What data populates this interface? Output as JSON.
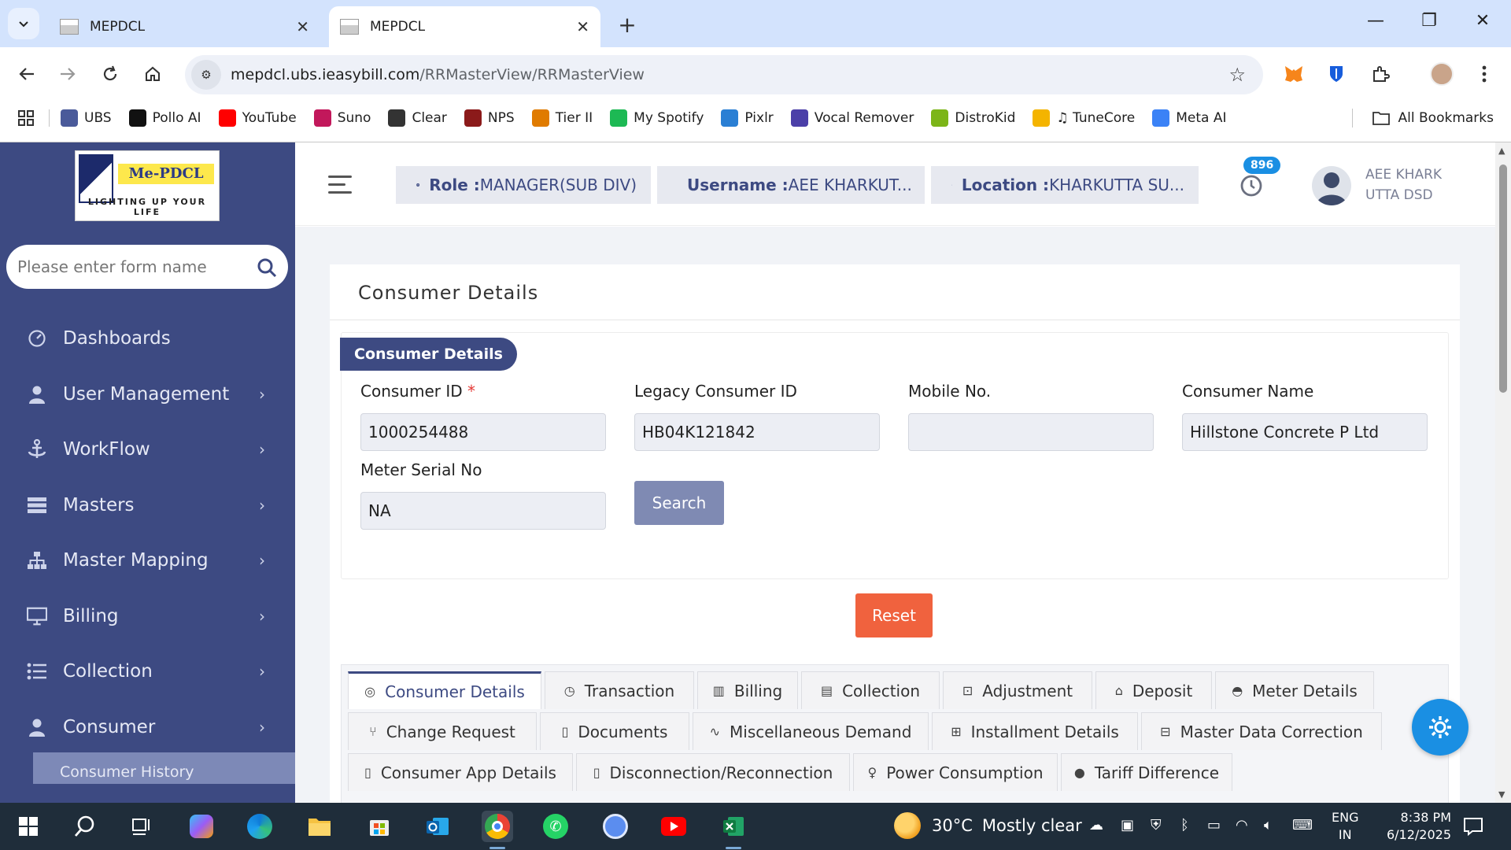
{
  "browser": {
    "tabs": [
      {
        "title": "MEPDCL",
        "active": false
      },
      {
        "title": "MEPDCL",
        "active": true
      }
    ],
    "url_host": "mepdcl.ubs.ieasybill.com",
    "url_path": "/RRMasterView/RRMasterView",
    "bookmarks": [
      {
        "label": "UBS",
        "icon": "ubs-icon",
        "color": "#4a5a9a"
      },
      {
        "label": "Pollo AI",
        "icon": "pollo-icon",
        "color": "#111111"
      },
      {
        "label": "YouTube",
        "icon": "youtube-icon",
        "color": "#ff0000"
      },
      {
        "label": "Suno",
        "icon": "suno-icon",
        "color": "#c2185b"
      },
      {
        "label": "Clear",
        "icon": "gear-icon",
        "color": "#333333"
      },
      {
        "label": "NPS",
        "icon": "nps-icon",
        "color": "#8b1a1a"
      },
      {
        "label": "Tier II",
        "icon": "tier-icon",
        "color": "#e07b00"
      },
      {
        "label": "My Spotify",
        "icon": "spotify-icon",
        "color": "#1db954"
      },
      {
        "label": "Pixlr",
        "icon": "pixlr-icon",
        "color": "#2a7fd4"
      },
      {
        "label": "Vocal Remover",
        "icon": "vocal-icon",
        "color": "#4b3fa8"
      },
      {
        "label": "DistroKid",
        "icon": "distrokid-icon",
        "color": "#7cb518"
      },
      {
        "label": "♫ TuneCore",
        "icon": "tunecore-icon",
        "color": "#f4b400"
      },
      {
        "label": "Meta AI",
        "icon": "meta-icon",
        "color": "#3b82f6"
      }
    ],
    "all_bookmarks": "All Bookmarks"
  },
  "sidebar": {
    "search_placeholder": "Please enter form name",
    "logo_brand": "Me-PDCL",
    "logo_tagline": "LIGHTING UP YOUR LIFE",
    "items": [
      {
        "label": "Dashboards",
        "icon": "dashboard-icon",
        "has_children": false
      },
      {
        "label": "User Management",
        "icon": "user-icon",
        "has_children": true
      },
      {
        "label": "WorkFlow",
        "icon": "anchor-icon",
        "has_children": true
      },
      {
        "label": "Masters",
        "icon": "stack-icon",
        "has_children": true
      },
      {
        "label": "Master Mapping",
        "icon": "sitemap-icon",
        "has_children": true
      },
      {
        "label": "Billing",
        "icon": "monitor-icon",
        "has_children": true
      },
      {
        "label": "Collection",
        "icon": "list-icon",
        "has_children": true
      },
      {
        "label": "Consumer",
        "icon": "user-icon",
        "has_children": true
      }
    ],
    "sub_item": "Consumer History"
  },
  "header": {
    "role_label": "Role :",
    "role_value": "MANAGER(SUB DIV)",
    "username_label": "Username :",
    "username_value": "AEE KHARKUT...",
    "location_label": "Location :",
    "location_value": "KHARKUTTA SU...",
    "notification_count": "896",
    "user_name": "AEE KHARK UTTA DSD"
  },
  "main": {
    "page_title": "Consumer Details",
    "section_title": "Consumer Details",
    "fields": {
      "consumer_id_label": "Consumer ID",
      "consumer_id_value": "1000254488",
      "legacy_id_label": "Legacy Consumer ID",
      "legacy_id_value": "HB04K121842",
      "mobile_label": "Mobile No.",
      "mobile_value": "",
      "name_label": "Consumer Name",
      "name_value": "Hillstone Concrete P Ltd",
      "meter_label": "Meter Serial No",
      "meter_value": "NA"
    },
    "search_label": "Search",
    "reset_label": "Reset",
    "tabs": [
      {
        "label": "Consumer Details",
        "icon": "target-icon",
        "active": true
      },
      {
        "label": "Transaction",
        "icon": "history-icon"
      },
      {
        "label": "Billing",
        "icon": "bar-chart-icon"
      },
      {
        "label": "Collection",
        "icon": "collection-icon"
      },
      {
        "label": "Adjustment",
        "icon": "adjustment-icon"
      },
      {
        "label": "Deposit",
        "icon": "bank-icon"
      },
      {
        "label": "Meter Details",
        "icon": "gauge-icon"
      },
      {
        "label": "Change Request",
        "icon": "git-icon"
      },
      {
        "label": "Documents",
        "icon": "document-icon"
      },
      {
        "label": "Miscellaneous Demand",
        "icon": "pulse-icon"
      },
      {
        "label": "Installment Details",
        "icon": "installment-icon"
      },
      {
        "label": "Master Data Correction",
        "icon": "correction-icon"
      },
      {
        "label": "Consumer App Details",
        "icon": "mobile-icon"
      },
      {
        "label": "Disconnection/Reconnection",
        "icon": "mobile-icon"
      },
      {
        "label": "Power Consumption",
        "icon": "bulb-icon"
      },
      {
        "label": "Tariff Difference",
        "icon": "circle-icon"
      }
    ]
  },
  "taskbar": {
    "weather_temp": "30°C",
    "weather_desc": "Mostly clear",
    "lang_1": "ENG",
    "lang_2": "IN",
    "time": "8:38 PM",
    "date": "6/12/2025"
  }
}
